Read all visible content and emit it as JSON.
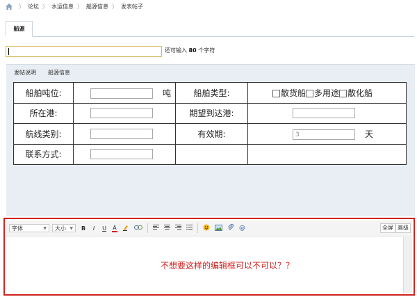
{
  "breadcrumb": {
    "items": [
      "论坛",
      "水运信息",
      "船源信息",
      "发表帖子"
    ]
  },
  "tabs": {
    "active": "船源"
  },
  "title_field": {
    "value": "",
    "hint_prefix": "还可输入 ",
    "hint_count": "80",
    "hint_suffix": " 个字符"
  },
  "info_tabs": [
    "发帖说明",
    "船源信息"
  ],
  "form": {
    "tonnage_label": "船舶吨位:",
    "tonnage_unit": "吨",
    "type_label": "船舶类型:",
    "type_options": [
      "散货船",
      "多用途",
      "散化船"
    ],
    "port_label": "所在港:",
    "dest_label": "期望到达港:",
    "route_label": "航线类别:",
    "validity_label": "有效期:",
    "validity_value": "3",
    "validity_unit": "天",
    "contact_label": "联系方式:"
  },
  "editor": {
    "font_select": "字体",
    "size_select": "大小",
    "buttons": [
      "B",
      "I",
      "U",
      "A"
    ],
    "fullscreen": "全屏",
    "advanced": "高级",
    "content": "不想要这样的编辑框可以不可以？？"
  },
  "colors": {
    "accent_red": "#d0231f",
    "panel_bg": "#e8eef4",
    "title_border": "#d7b85c"
  }
}
